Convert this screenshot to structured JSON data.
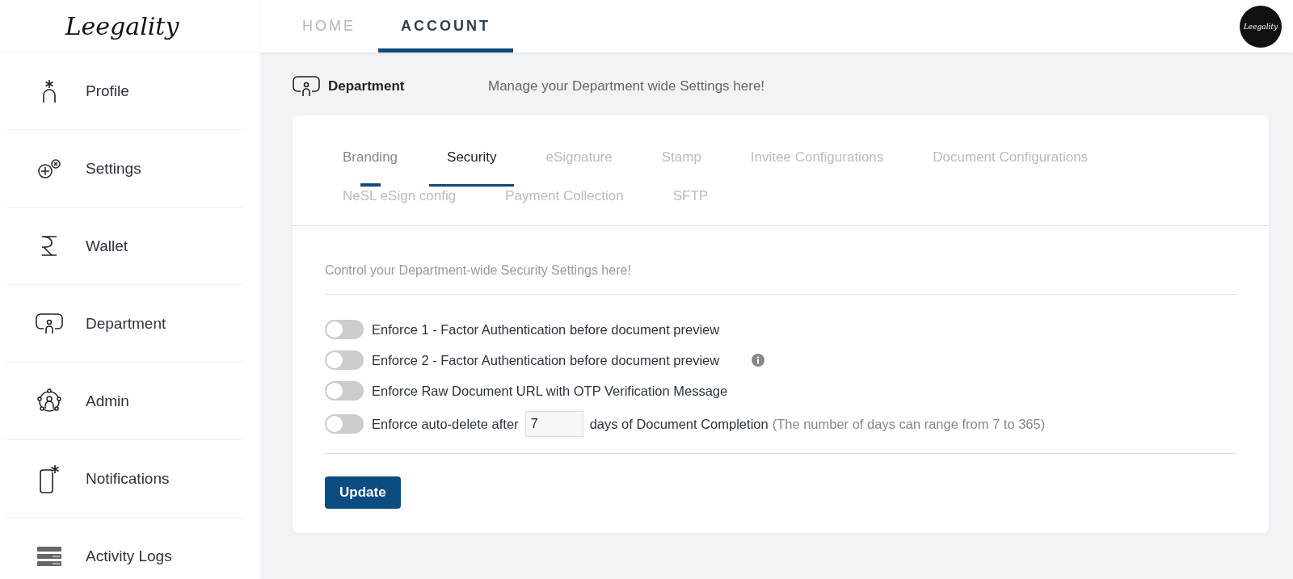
{
  "header": {
    "logo": "Leegality",
    "nav": [
      {
        "label": "HOME",
        "selected": false
      },
      {
        "label": "ACCOUNT",
        "selected": true
      }
    ],
    "avatar_logo": "Leegality"
  },
  "sidebar": {
    "items": [
      {
        "label": "Profile"
      },
      {
        "label": "Settings"
      },
      {
        "label": "Wallet"
      },
      {
        "label": "Department"
      },
      {
        "label": "Admin"
      },
      {
        "label": "Notifications"
      },
      {
        "label": "Activity Logs"
      }
    ]
  },
  "page_header": {
    "title": "Department",
    "subtitle": "Manage your Department wide Settings here!"
  },
  "tabs": [
    {
      "label": "Branding",
      "selected": false,
      "disabled": false,
      "hovered": true
    },
    {
      "label": "Security",
      "selected": true,
      "disabled": false,
      "hovered": false
    },
    {
      "label": "eSignature",
      "selected": false,
      "disabled": true,
      "hovered": false
    },
    {
      "label": "Stamp",
      "selected": false,
      "disabled": true,
      "hovered": false
    },
    {
      "label": "Invitee Configurations",
      "selected": false,
      "disabled": true,
      "hovered": false
    },
    {
      "label": "Document Configurations",
      "selected": false,
      "disabled": true,
      "hovered": false
    },
    {
      "label": "NeSL eSign config",
      "selected": false,
      "disabled": true,
      "hovered": false
    },
    {
      "label": "Payment Collection",
      "selected": false,
      "disabled": true,
      "hovered": false
    },
    {
      "label": "SFTP",
      "selected": false,
      "disabled": true,
      "hovered": false
    }
  ],
  "section_intro": "Control your Department-wide Security Settings here!",
  "settings": [
    {
      "kind": "toggle",
      "label": "Enforce 1 - Factor Authentication before document preview",
      "on": false,
      "info": false
    },
    {
      "kind": "toggle",
      "label": "Enforce 2 - Factor Authentication before document preview",
      "on": false,
      "info": true
    },
    {
      "kind": "toggle",
      "label": "Enforce Raw Document URL with OTP Verification Message",
      "on": false,
      "info": false
    },
    {
      "kind": "days",
      "label": "Enforce auto-delete after",
      "value": "7",
      "suffix": "days of Document Completion",
      "hint": "(The number of days can range from 7 to 365)",
      "on": false,
      "info": false
    }
  ],
  "update_button": "Update"
}
